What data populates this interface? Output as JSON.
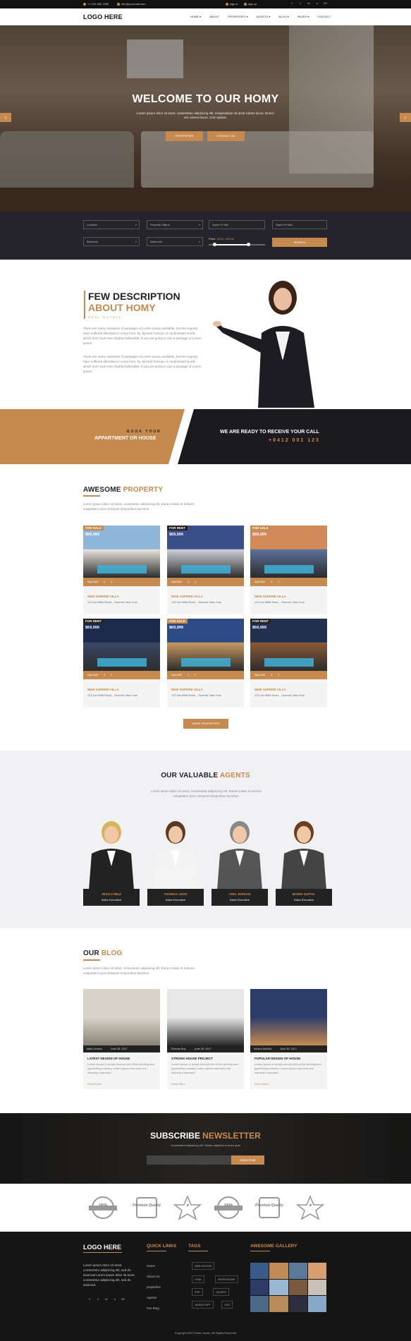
{
  "topbar": {
    "phone": "+1 223 456 7890",
    "email": "info@yourmail.com",
    "sign_in": "sign in",
    "sign_up": "sign up",
    "social": [
      "f",
      "t",
      "in",
      "v",
      "G+"
    ]
  },
  "nav": {
    "logo": "LOGO HERE",
    "items": [
      "HOME ▾",
      "ABOUT",
      "PROPERTIES ▾",
      "AGENTS ▾",
      "BLOG ▾",
      "PAGES ▾",
      "CONTACT"
    ]
  },
  "hero": {
    "title": "WELCOME TO OUR HOMY",
    "subtitle": "Lorem ipsum dolor sit amet, consectetur adipiscing elit. Suspendisse sit amet rutrum lacus. Donec nec viverra lacus. Cum apisse.",
    "btn_properties": "PROPERTIES",
    "btn_contact": "CONTACT US",
    "prev": "‹",
    "next": "›"
  },
  "search": {
    "location": "Location",
    "status": "Property Status",
    "sqft_min": "Squre Ft Min",
    "sqft_max": "Squre Ft Max",
    "bedroom": "Bedroom",
    "bathroom": "Bathroom",
    "price_label": "Price : ",
    "price_range": "$100 - $1000",
    "price_range_fraction": [
      0.1,
      0.7
    ],
    "search_btn": "SEARCH"
  },
  "about": {
    "title1": "FEW DESCRIPTION",
    "title2": "ABOUT HOMY",
    "tag": "REAL ESTATE",
    "para1": "There are many variations of passages of Lorem Ipsum available, but the majority have suffered alteration in some form, by injected humour, or randomised words which don't look even slightly believable. If you are going to use a passage of Lorem Ipsum.",
    "para2": "There are many variations of passages of Lorem Ipsum available, but the majority have suffered alteration in some form, by injected humour, or randomised words which don't look even slightly believable. If you are going to use a passage of Lorem Ipsum."
  },
  "band": {
    "book1": "BOOK YOUR",
    "book2": "APPARTMENT OR HOUSE",
    "call": "WE ARE READY TO RECEIVE YOUR CALL",
    "phone": "+0412 001 123"
  },
  "property": {
    "title_a": "AWESOME ",
    "title_b": "PROPERTY",
    "sub": "Lorem ipsum dolor sit amet, consectetur adipiscing elit. Earum totam et dolores voluptatem porro tempore temporibus ducimus.",
    "cards": [
      {
        "tag": "FOR SALE",
        "price": "$69,999",
        "sqft": "Sqft-3000",
        "beds": "3",
        "baths": "2",
        "name": "NEW SUPERB VILLA",
        "addr": "123 1st Wllth Road ,, Summit, New York",
        "tagColor": "#c68a4f",
        "sky": "#8fb6d8",
        "body": "#e8e3da"
      },
      {
        "tag": "FOR RENT",
        "price": "$69,999",
        "sqft": "Sqft-3000",
        "beds": "3",
        "baths": "2",
        "name": "NEW SUPERB VILLA",
        "addr": "123 1st Wllth Road ,, Summit, New York",
        "tagColor": "#222",
        "sky": "#3b4f8a",
        "body": "#cfcfd8"
      },
      {
        "tag": "FOR SALE",
        "price": "$69,999",
        "sqft": "Sqft-3000",
        "beds": "3",
        "baths": "2",
        "name": "NEW SUPERB VILLA",
        "addr": "123 1st Wllth Road ,, Summit, New York",
        "tagColor": "#c68a4f",
        "sky": "#d28a5a",
        "body": "#5b6f9a"
      },
      {
        "tag": "FOR RENT",
        "price": "$69,999",
        "sqft": "Sqft-3000",
        "beds": "3",
        "baths": "2",
        "name": "NEW SUPERB VILLA",
        "addr": "123 1st Wllth Road ,, Summit, New York",
        "tagColor": "#222",
        "sky": "#1c2a4e",
        "body": "#3a4766"
      },
      {
        "tag": "FOR SALE",
        "price": "$69,999",
        "sqft": "Sqft-3000",
        "beds": "3",
        "baths": "2",
        "name": "NEW SUPERB VILLA",
        "addr": "123 1st Wllth Road ,, Summit, New York",
        "tagColor": "#c68a4f",
        "sky": "#2c4a86",
        "body": "#c89a62"
      },
      {
        "tag": "FOR RENT",
        "price": "$69,999",
        "sqft": "Sqft-3000",
        "beds": "3",
        "baths": "2",
        "name": "NEW SUPERB VILLA",
        "addr": "123 1st Wllth Road ,, Summit, New York",
        "tagColor": "#222",
        "sky": "#22304f",
        "body": "#8a5a36"
      }
    ],
    "more_btn": "MORE PROPERTIES"
  },
  "agents": {
    "title_a": "OUR VALUABLE ",
    "title_b": "AGENTS",
    "sub": "Lorem ipsum dolor sit amet, consectetur adipiscing elit. Earum totam et dolores voluptatem porro tempore temporibus ducimus.",
    "list": [
      {
        "name": "JESICA MILE",
        "role": "Sales Executive",
        "hair": "#d6b45a",
        "suit": "#222"
      },
      {
        "name": "THOMAS JONS",
        "role": "Sales Executive",
        "hair": "#5a3a22",
        "suit": "#f4f4f4"
      },
      {
        "name": "CRIS JORDAN",
        "role": "Sales Executive",
        "hair": "#888",
        "suit": "#555"
      },
      {
        "name": "MARRI GUPTIL",
        "role": "Sales Executive",
        "hair": "#6b3e1e",
        "suit": "#444"
      }
    ]
  },
  "blog": {
    "title_a": "OUR ",
    "title_b": "BLOG",
    "sub": "Lorem ipsum dolor sit amet, consectetur adipiscing elit. Earum totam et dolores voluptatem porro tempore temporibus ducimus.",
    "posts": [
      {
        "author": "Mark Jonson",
        "date": "June 28, 2017",
        "title": "LATEST DESIGN OF HOUSE",
        "body": "Lorem Ipsum is simply dummy text of the printing and typesetting industry. Lorem Ipsum has been the industry's standard.",
        "more": "Read More",
        "c1": "#d8d2c8",
        "c2": "#8a8276"
      },
      {
        "author": "Thomas Roy",
        "date": "June 29, 2017",
        "title": "STRONG HOUSE PROJECT",
        "body": "Lorem Ipsum is simply dummy text of the printing and typesetting industry. Lorem Ipsum has been the industry's standard.",
        "more": "Read More",
        "c1": "#e8e8e8",
        "c2": "#2a2a2a"
      },
      {
        "author": "Nelson Monika",
        "date": "June 30, 2017",
        "title": "POPULAR DESIGN OF HOUSE",
        "body": "Lorem Ipsum is simply dummy text of the printing and typesetting industry. Lorem Ipsum has been the industry's standard.",
        "more": "Read More",
        "c1": "#2c3d6a",
        "c2": "#c88a52"
      }
    ]
  },
  "newsletter": {
    "title_a": "SUBSCRIBE ",
    "title_b": "NEWSLETTER",
    "sub": "consectetur adipiscing elit. Nullam dapibus in enim quat",
    "btn": "SUBSCRIBE"
  },
  "badges": [
    "100%",
    "Premium Quality",
    "★",
    "100%",
    "Premium Quality",
    "★"
  ],
  "footer": {
    "logo": "LOGO HERE",
    "text": "Lorem ipsum dolor sit amet, consectetur adipiscing elit, sed do eiusmod Lorem ipsum dolor sit amet, consectetur adipiscing elit, sed do eiusmod.",
    "quick_title": "QUICK LINKS",
    "quick": [
      "Home",
      "About Us",
      "properties",
      "Agents",
      "Our Blog"
    ],
    "tags_title": "TAGS",
    "tags": [
      "WEB DESIGN",
      "HTML",
      "RESPONSIVE",
      "PHP",
      "JQUERY",
      "JAVASCRIPT",
      "CSS"
    ],
    "gallery_title": "AWESOME GALLERY",
    "copyright": "Copyright 2022 Demo Name. All Rights Reserved"
  },
  "colors": {
    "accent": "#c68a4f",
    "dark": "#1b1b1f"
  }
}
